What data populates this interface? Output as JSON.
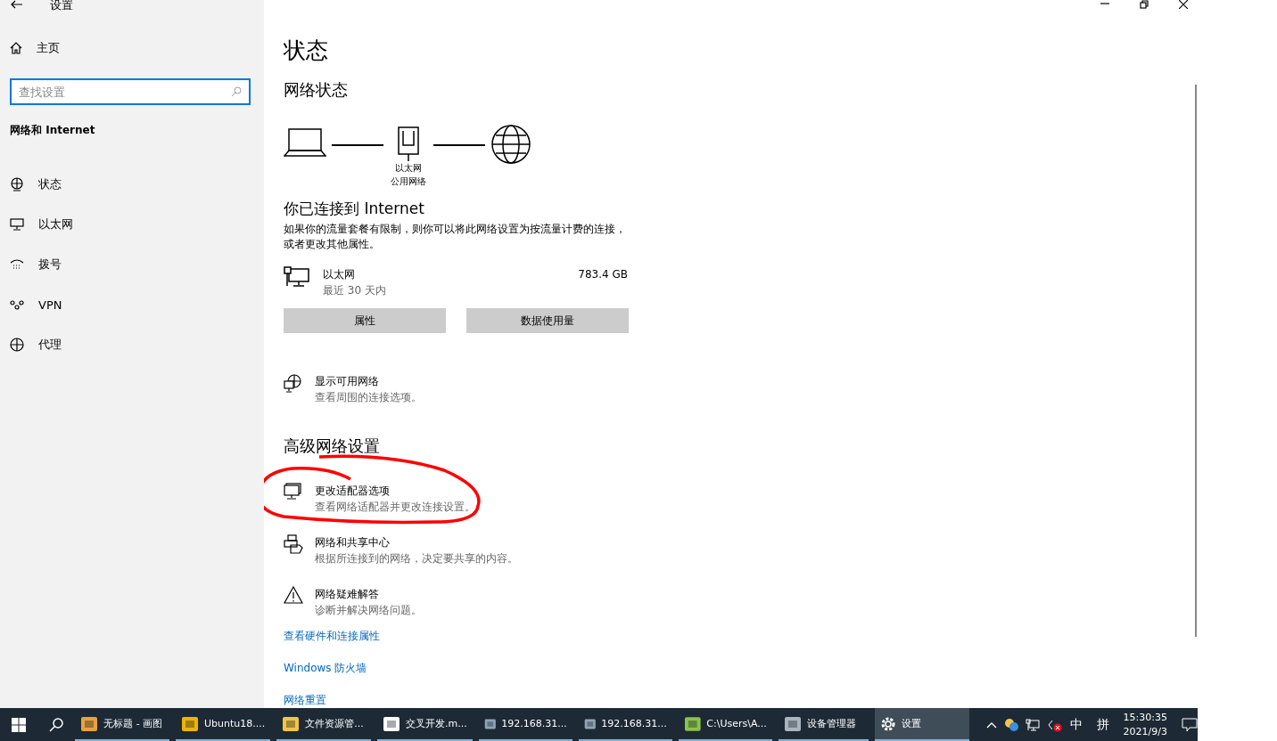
{
  "window": {
    "title": "设置"
  },
  "sidebar": {
    "home": "主页",
    "search": {
      "placeholder": "查找设置"
    },
    "section": "网络和 Internet",
    "items": [
      {
        "label": "状态"
      },
      {
        "label": "以太网"
      },
      {
        "label": "拨号"
      },
      {
        "label": "VPN"
      },
      {
        "label": "代理"
      }
    ]
  },
  "main": {
    "title": "状态",
    "network_status": "网络状态",
    "diagram_labels": [
      "以太网",
      "公用网络"
    ],
    "connected_heading": "你已连接到 Internet",
    "connected_text": "如果你的流量套餐有限制，则你可以将此网络设置为按流量计费的连接，或者更改其他属性。",
    "usage": {
      "name": "以太网",
      "period": "最近 30 天内",
      "amount": "783.4 GB"
    },
    "buttons": [
      "属性",
      "数据使用量"
    ],
    "show_networks": {
      "title": "显示可用网络",
      "desc": "查看周围的连接选项。"
    },
    "advanced_heading": "高级网络设置",
    "options": [
      {
        "title": "更改适配器选项",
        "desc": "查看网络适配器并更改连接设置。",
        "circled": true
      },
      {
        "title": "网络和共享中心",
        "desc": "根据所连接到的网络，决定要共享的内容。",
        "circled": false
      },
      {
        "title": "网络疑难解答",
        "desc": "诊断并解决网络问题。",
        "circled": false
      }
    ],
    "links": [
      "查看硬件和连接属性",
      "Windows 防火墙",
      "网络重置"
    ]
  },
  "taskbar": {
    "apps": [
      {
        "label": "无标题 - 画图",
        "running": true,
        "selected": false
      },
      {
        "label": "Ubuntu18....",
        "running": true,
        "selected": false
      },
      {
        "label": "文件资源管...",
        "running": true,
        "selected": false
      },
      {
        "label": "交叉开发.m...",
        "running": true,
        "selected": false
      },
      {
        "label": "192.168.31...",
        "running": true,
        "selected": false
      },
      {
        "label": "192.168.31...",
        "running": true,
        "selected": false
      },
      {
        "label": "C:\\Users\\A...",
        "running": true,
        "selected": false
      },
      {
        "label": "设备管理器",
        "running": true,
        "selected": false
      },
      {
        "label": "设置",
        "running": true,
        "selected": true
      }
    ],
    "tray": {
      "ime": "中",
      "ime_mode": "拼",
      "time": "15:30:35",
      "date": "2021/9/3"
    }
  }
}
